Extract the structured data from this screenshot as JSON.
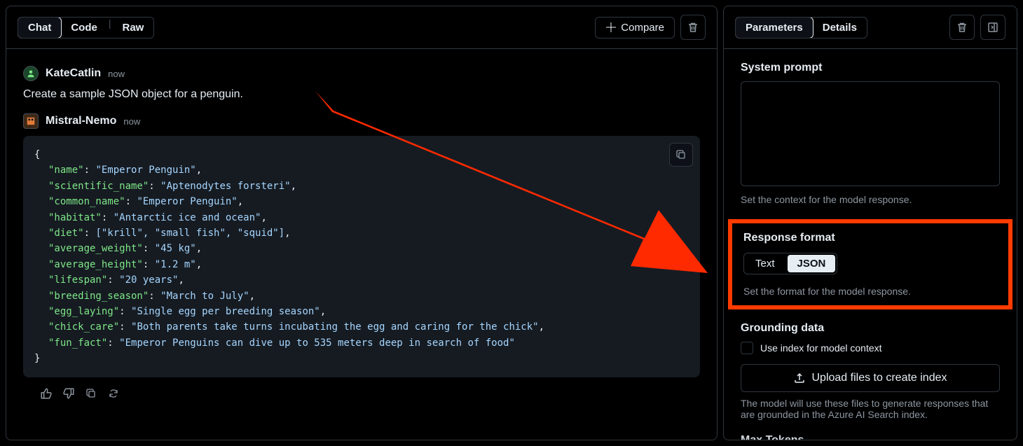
{
  "left": {
    "tabs": {
      "chat": "Chat",
      "code": "Code",
      "raw": "Raw"
    },
    "compare": "Compare",
    "user": {
      "name": "KateCatlin",
      "time": "now",
      "message": "Create a sample JSON object for a penguin."
    },
    "model": {
      "name": "Mistral-Nemo",
      "time": "now"
    },
    "json": {
      "name_k": "\"name\"",
      "name_v": "\"Emperor Penguin\"",
      "sci_k": "\"scientific_name\"",
      "sci_v": "\"Aptenodytes forsteri\"",
      "common_k": "\"common_name\"",
      "common_v": "\"Emperor Penguin\"",
      "habitat_k": "\"habitat\"",
      "habitat_v": "\"Antarctic ice and ocean\"",
      "diet_k": "\"diet\"",
      "diet_v": "[\"krill\", \"small fish\", \"squid\"]",
      "weight_k": "\"average_weight\"",
      "weight_v": "\"45 kg\"",
      "height_k": "\"average_height\"",
      "height_v": "\"1.2 m\"",
      "life_k": "\"lifespan\"",
      "life_v": "\"20 years\"",
      "breed_k": "\"breeding_season\"",
      "breed_v": "\"March to July\"",
      "egg_k": "\"egg_laying\"",
      "egg_v": "\"Single egg per breeding season\"",
      "chick_k": "\"chick_care\"",
      "chick_v": "\"Both parents take turns incubating the egg and caring for the chick\"",
      "fun_k": "\"fun_fact\"",
      "fun_v": "\"Emperor Penguins can dive up to 535 meters deep in search of food\""
    }
  },
  "right": {
    "tabs": {
      "parameters": "Parameters",
      "details": "Details"
    },
    "system_prompt": {
      "title": "System prompt",
      "help": "Set the context for the model response."
    },
    "response_format": {
      "title": "Response format",
      "text": "Text",
      "json": "JSON",
      "help": "Set the format for the model response."
    },
    "grounding": {
      "title": "Grounding data",
      "checkbox": "Use index for model context",
      "upload": "Upload files to create index",
      "help": "The model will use these files to generate responses that are grounded in the Azure AI Search index."
    },
    "max_tokens": {
      "title": "Max Tokens"
    }
  }
}
